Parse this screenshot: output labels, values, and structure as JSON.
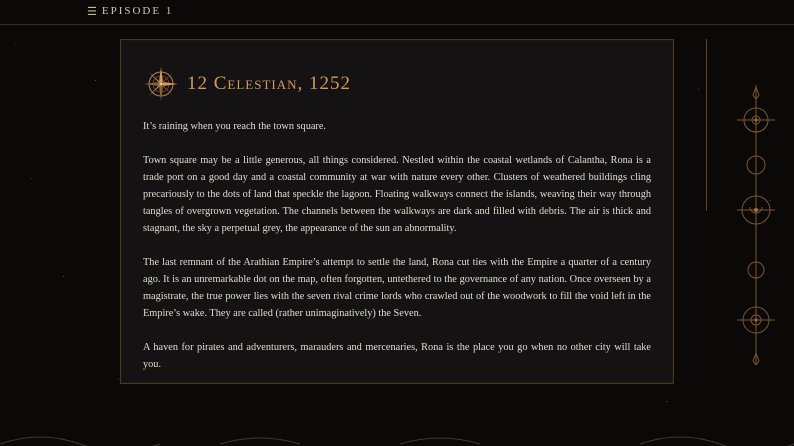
{
  "header": {
    "menu_icon": "hamburger-menu-icon",
    "episode_label": "EPISODE 1"
  },
  "entry": {
    "icon": "compass-rose-icon",
    "date": "12 Celestian, 1252",
    "paragraphs": [
      "It’s raining when you reach the town square.",
      "Town square may be a little generous, all things considered. Nestled within the coastal wetlands of Calantha, Rona is a trade port on a good day and a coastal community at war with nature every other. Clusters of weathered buildings cling precariously to the dots of land that speckle the lagoon. Floating walkways connect the islands, weaving their way through tangles of overgrown vegetation. The channels between the walkways are dark and filled with debris. The air is thick and stagnant, the sky a perpetual grey, the appearance of the sun an abnormality.",
      "The last remnant of the Arathian Empire’s attempt to settle the land, Rona cut ties with the Empire a quarter of a century ago. It is an unremarkable dot on the map, often forgotten, untethered to the governance of any nation. Once overseen by a magistrate, the true power lies with the seven rival crime lords who crawled out of the woodwork to fill the void left in the Empire’s wake. They are called (rather unimaginatively) the Seven.",
      "A haven for pirates and adventurers, marauders and mercenaries, Rona is the place you go when no other city will take you."
    ]
  },
  "colors": {
    "accent": "#d29a5e",
    "panel_bg": "#141212",
    "page_bg": "#0b0908",
    "text": "#e2dccf"
  }
}
